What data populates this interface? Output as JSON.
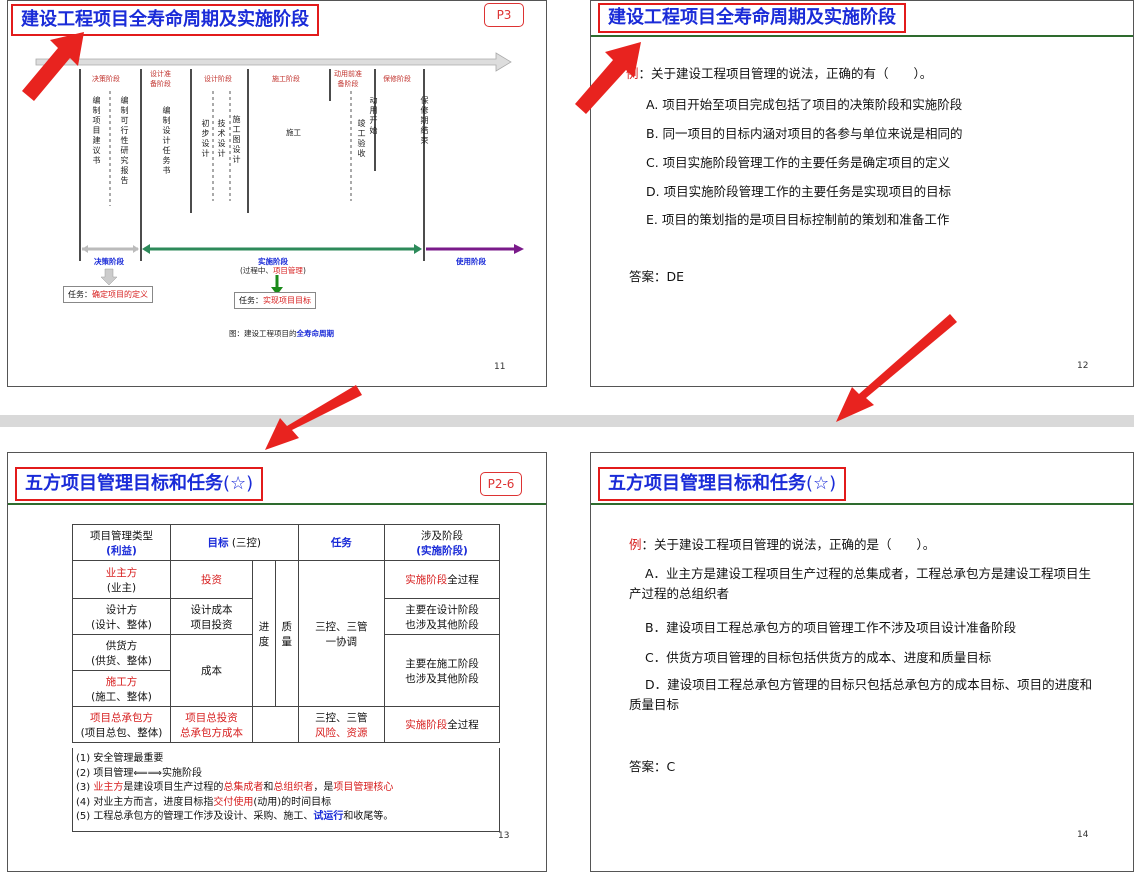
{
  "slides": [
    {
      "title": "建设工程项目全寿命周期及实施阶段",
      "tag": "P3",
      "page": "11",
      "diagram": {
        "phases": [
          "决策阶段",
          "设计准\n备阶段",
          "设计阶段",
          "施工阶段",
          "动用前准\n备阶段",
          "保修阶段"
        ],
        "vtexts": [
          "编制项目建议书",
          "编制可行性研究报告",
          "编制设计任务书",
          "初步设计",
          "技术设计",
          "施工图设计",
          "施工",
          "竣工验收",
          "动用开始",
          "保修期结束"
        ],
        "bottom_decision": "决策阶段",
        "bottom_impl": "实施阶段",
        "bottom_impl_sub_a": "(过程中、",
        "bottom_impl_sub_b": "项目管理",
        "bottom_impl_sub_c": ")",
        "bottom_use": "使用阶段",
        "task1_prefix": "任务：",
        "task1_red": "确定项目的定义",
        "task2_prefix": "任务：",
        "task2_red": "实现项目目标",
        "caption_prefix": "图：建设工程项目的",
        "caption_bold": "全寿命周期"
      }
    },
    {
      "title": "建设工程项目全寿命周期及实施阶段",
      "page": "12",
      "question_prefix": "例",
      "question": "：关于建设工程项目管理的说法，正确的有（　　）。",
      "options": [
        "A. 项目开始至项目完成包括了项目的决策阶段和实施阶段",
        "B. 同一项目的目标内涵对项目的各参与单位来说是相同的",
        "C. 项目实施阶段管理工作的主要任务是确定项目的定义",
        "D. 项目实施阶段管理工作的主要任务是实现项目的目标",
        "E. 项目的策划指的是项目目标控制前的策划和准备工作"
      ],
      "answer": "答案：DE"
    },
    {
      "title": "五方项目管理目标和任务",
      "title_star": "(☆)",
      "tag": "P2-6",
      "page": "13",
      "table": {
        "h1a": "项目管理类型",
        "h1b": "(利益)",
        "h2a": "目标",
        "h2b": " (三控)",
        "h3": "任务",
        "h4a": "涉及阶段",
        "h4b": "(实施阶段)",
        "r1a": "业主方",
        "r1b": "(业主)",
        "r1goal": "投资",
        "r1stage_red": "实施阶段",
        "r1stage": "全过程",
        "r2a": "设计方",
        "r2b": "(设计、整体)",
        "r2goal": "设计成本\n项目投资",
        "r2stage": "主要在设计阶段\n也涉及其他阶段",
        "jindu": "进\n度",
        "zhiliang": "质\n量",
        "task_mid": "三控、三管\n一协调",
        "r3a": "供货方",
        "r3b": "(供货、整体)",
        "r3goal": "成本",
        "r3stage": "主要在施工阶段\n也涉及其他阶段",
        "r4a": "施工方",
        "r4b": "(施工、整体)",
        "r5a": "项目总承包方",
        "r5b": "(项目总包、整体)",
        "r5goal": "项目总投资\n总承包方成本",
        "r5task_a": "三控、三管",
        "r5task_b": "风险、资源",
        "r5stage_red": "实施阶段",
        "r5stage": "全过程"
      },
      "notes": {
        "n1": "(1) 安全管理最重要",
        "n2": "(2) 项目管理⟸⟹实施阶段",
        "n3_a": "(3) ",
        "n3_b": "业主方",
        "n3_c": "是建设项目生产过程的",
        "n3_d": "总集成者",
        "n3_e": "和",
        "n3_f": "总组织者",
        "n3_g": "，是",
        "n3_h": "项目管理核心",
        "n4_a": "(4) 对业主方而言，进度目标指",
        "n4_b": "交付使用",
        "n4_c": "(动用)的时间目标",
        "n5_a": "(5) 工程总承包方的管理工作涉及设计、采购、施工、",
        "n5_b": "试运行",
        "n5_c": "和收尾等。"
      }
    },
    {
      "title": "五方项目管理目标和任务",
      "title_star": "(☆)",
      "page": "14",
      "question_prefix": "例",
      "question": "：关于建设工程项目管理的说法，正确的是（　　）。",
      "options": [
        "A．业主方是建设工程项目生产过程的总集成者，工程总承包方是建设工程项目生产过程的总组织者",
        "B．建设项目工程总承包方的项目管理工作不涉及项目设计准备阶段",
        "C．供货方项目管理的目标包括供货方的成本、进度和质量目标",
        "D．建设项目工程总承包方管理的目标只包括总承包方的成本目标、项目的进度和质量目标"
      ],
      "answer": "答案：C"
    }
  ],
  "colors": {
    "accent_red": "#e21b1b",
    "title_blue": "#1a2bd8",
    "header_green": "#2e6b2e"
  }
}
